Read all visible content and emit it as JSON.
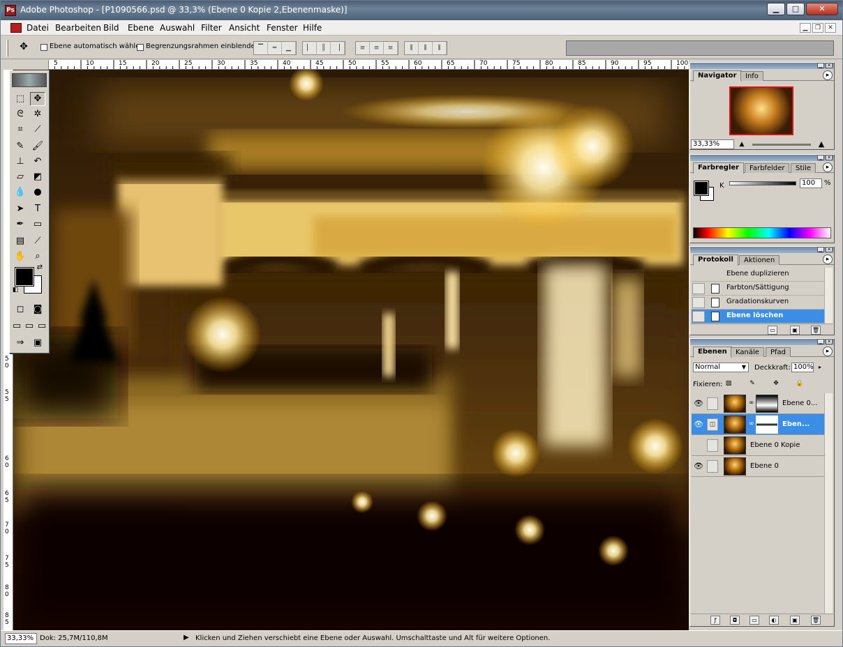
{
  "window": {
    "title": "Adobe Photoshop - [P1090566.psd @ 33,3% (Ebene 0 Kopie 2,Ebenenmaske)]",
    "minimize": "▁",
    "maximize": "□",
    "close": "✕"
  },
  "menu": {
    "items": [
      "Datei",
      "Bearbeiten",
      "Bild",
      "Ebene",
      "Auswahl",
      "Filter",
      "Ansicht",
      "Fenster",
      "Hilfe"
    ]
  },
  "options": {
    "auto_select_label": "Ebene automatisch wählen",
    "bounding_box_label": "Begrenzungsrahmen einblenden"
  },
  "rulers": {
    "horizontal": [
      "5",
      "10",
      "15",
      "20",
      "25",
      "30",
      "35",
      "40",
      "45",
      "50",
      "55",
      "60",
      "65",
      "70",
      "75",
      "80",
      "85",
      "90",
      "95",
      "100"
    ],
    "vertical": [
      "5",
      "0",
      "5",
      "5",
      "6",
      "0",
      "6",
      "5",
      "7",
      "0",
      "7",
      "5",
      "8",
      "0",
      "8",
      "5"
    ]
  },
  "navigator": {
    "tabs": [
      "Navigator",
      "Info"
    ],
    "zoom": "33,33%"
  },
  "color": {
    "tabs": [
      "Farbregler",
      "Farbfelder",
      "Stile"
    ],
    "channel": "K",
    "value": "100",
    "unit": "%"
  },
  "history": {
    "tabs": [
      "Protokoll",
      "Aktionen"
    ],
    "items": [
      {
        "label": "Ebene duplizieren",
        "selected": false
      },
      {
        "label": "Farbton/Sättigung",
        "selected": false
      },
      {
        "label": "Gradationskurven",
        "selected": false
      },
      {
        "label": "Ebene löschen",
        "selected": true
      }
    ]
  },
  "layers": {
    "tabs": [
      "Ebenen",
      "Kanäle",
      "Pfad"
    ],
    "blend_mode": "Normal",
    "opacity_label": "Deckkraft:",
    "opacity": "100%",
    "lock_label": "Fixieren:",
    "items": [
      {
        "name": "Ebene 0...",
        "visible": true,
        "has_mask": true,
        "selected": false
      },
      {
        "name": "Eben...",
        "visible": true,
        "has_mask": true,
        "selected": true
      },
      {
        "name": "Ebene 0 Kopie",
        "visible": false,
        "has_mask": false,
        "selected": false
      },
      {
        "name": "Ebene 0",
        "visible": true,
        "has_mask": false,
        "selected": false
      }
    ]
  },
  "status": {
    "zoom": "33,33%",
    "doc": "Dok: 25,7M/110,8M",
    "hint": "Klicken und Ziehen verschiebt eine Ebene oder Auswahl. Umschalttaste und Alt für weitere Optionen."
  }
}
